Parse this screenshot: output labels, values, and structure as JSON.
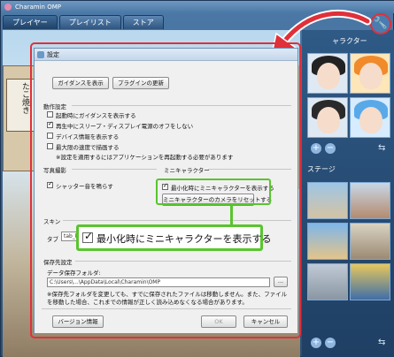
{
  "app": {
    "title": "Charamin OMP",
    "tabs": [
      {
        "label": "プレイヤー"
      },
      {
        "label": "プレイリスト"
      },
      {
        "label": "ストア"
      }
    ]
  },
  "scene": {
    "sign_text": "たこ焼き"
  },
  "right_panel": {
    "character_label": "ャラクター",
    "stage_label": "ステージ",
    "add_symbol": "+",
    "remove_symbol": "−",
    "arrows_symbol": "⇆"
  },
  "dialog": {
    "title": "設定",
    "buttons": {
      "guidance": "ガイダンスを表示",
      "plugin_update": "プラグインの更新",
      "reset_camera": "ミニキャラクターのカメラをリセットする",
      "version": "バージョン情報",
      "ok": "OK",
      "cancel": "キャンセル",
      "browse": "..."
    },
    "behavior": {
      "label": "動作設定",
      "items": [
        {
          "label": "起動時にガイダンスを表示する",
          "checked": false
        },
        {
          "label": "再生中にスリープ・ディスプレイ電源のオフをしない",
          "checked": true
        },
        {
          "label": "デバイス情報を表示する",
          "checked": false
        },
        {
          "label": "最大限の速度で描画する",
          "checked": false
        }
      ],
      "note": "※設定を適用するにはアプリケーションを再起動する必要があります"
    },
    "photo": {
      "label": "写真撮影",
      "shutter": {
        "label": "シャッター音を鳴らす",
        "checked": true
      }
    },
    "mini_char": {
      "label": "ミニキャラクター",
      "show": {
        "label": "最小化時にミニキャラクターを表示する",
        "checked": true
      }
    },
    "skin": {
      "label": "スキン",
      "type_label": "タブ",
      "type_value": "tab_b"
    },
    "save": {
      "label": "保存先設定",
      "folder_label": "データ保存フォルダ:",
      "folder_value": "C:\\Users\\...\\AppData\\Local\\Charamin\\OMP",
      "note_line1": "※保存先フォルダを変更しても、すでに保存されたファイルは移動しません。また、ファイル",
      "note_line2": "を移動した場合、これまでの情報が正しく読み込めなくなる場合があります。"
    }
  },
  "zoom": {
    "label": "最小化時にミニキャラクターを表示する",
    "checked": true
  },
  "colors": {
    "callout_red": "#e0303a",
    "highlight_green": "#59c42f"
  }
}
